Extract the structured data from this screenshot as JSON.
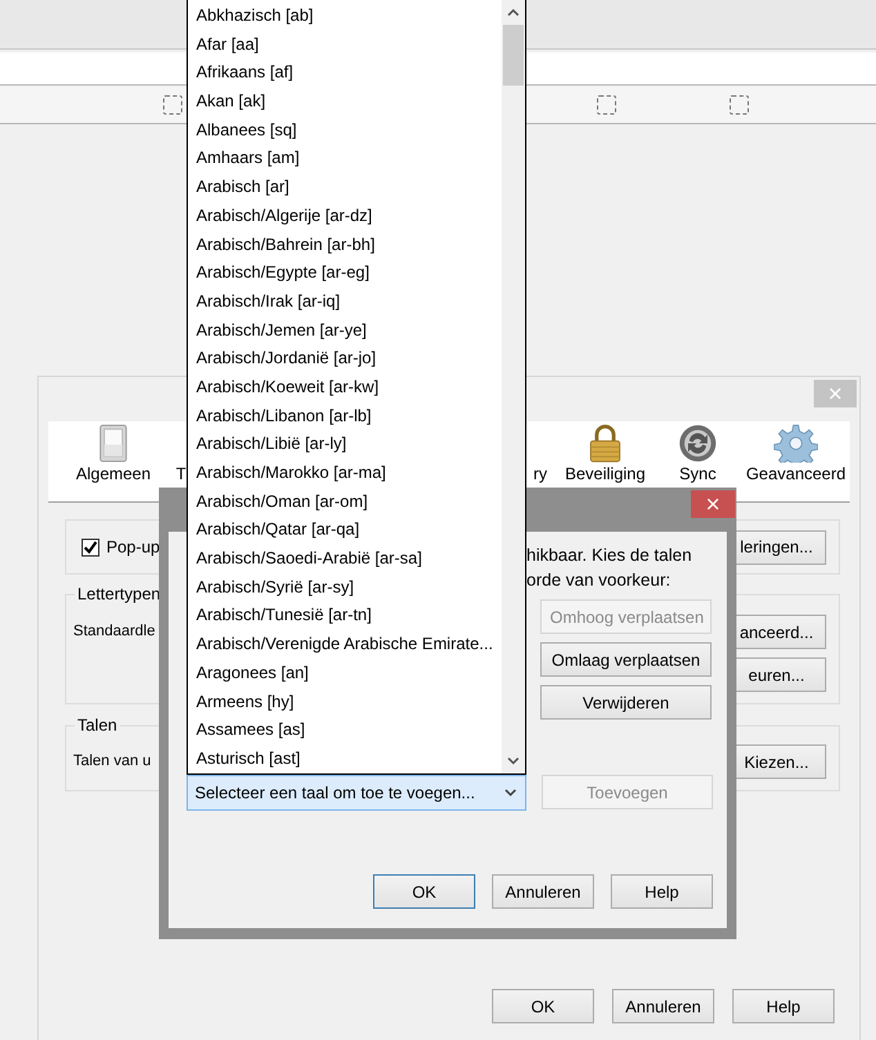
{
  "options_window": {
    "close": "×",
    "tabs": [
      {
        "label": "Algemeen",
        "kind": "switch"
      },
      {
        "label": "T",
        "kind": "hidden"
      },
      {
        "label": "ry",
        "kind": "hidden"
      },
      {
        "label": "Beveiliging",
        "kind": "lock"
      },
      {
        "label": "Sync",
        "kind": "sync"
      },
      {
        "label": "Geavanceerd",
        "kind": "gear"
      }
    ],
    "popups": {
      "label": "Pop-up",
      "checked": true,
      "button": "leringen..."
    },
    "fonts": {
      "title": "Lettertypen",
      "label": "Standaardle",
      "buttons": [
        "anceerd...",
        "euren..."
      ]
    },
    "languages": {
      "title": "Talen",
      "label": "Talen van u",
      "button": "Kiezen..."
    },
    "buttons": [
      "OK",
      "Annuleren",
      "Help"
    ]
  },
  "language_dialog": {
    "close": "×",
    "text_lines": [
      "hikbaar. Kies de talen",
      "orde van voorkeur:"
    ],
    "side_buttons": [
      {
        "label": "Omhoog verplaatsen",
        "disabled": true
      },
      {
        "label": "Omlaag verplaatsen",
        "disabled": false
      },
      {
        "label": "Verwijderen",
        "disabled": false
      }
    ],
    "select": {
      "value": "Selecteer een taal om toe te voegen..."
    },
    "add_button": {
      "label": "Toevoegen",
      "disabled": true
    },
    "buttons": [
      {
        "label": "OK",
        "focused": true
      },
      {
        "label": "Annuleren",
        "focused": false
      },
      {
        "label": "Help",
        "focused": false
      }
    ]
  },
  "dropdown": {
    "items": [
      "Abkhazisch  [ab]",
      "Afar  [aa]",
      "Afrikaans  [af]",
      "Akan  [ak]",
      "Albanees  [sq]",
      "Amhaars  [am]",
      "Arabisch  [ar]",
      "Arabisch/Algerije  [ar-dz]",
      "Arabisch/Bahrein  [ar-bh]",
      "Arabisch/Egypte  [ar-eg]",
      "Arabisch/Irak  [ar-iq]",
      "Arabisch/Jemen  [ar-ye]",
      "Arabisch/Jordanië  [ar-jo]",
      "Arabisch/Koeweit  [ar-kw]",
      "Arabisch/Libanon  [ar-lb]",
      "Arabisch/Libië  [ar-ly]",
      "Arabisch/Marokko  [ar-ma]",
      "Arabisch/Oman  [ar-om]",
      "Arabisch/Qatar  [ar-qa]",
      "Arabisch/Saoedi-Arabië  [ar-sa]",
      "Arabisch/Syrië  [ar-sy]",
      "Arabisch/Tunesië  [ar-tn]",
      "Arabisch/Verenigde Arabische Emirate...",
      "Aragonees  [an]",
      "Armeens  [hy]",
      "Assamees  [as]",
      "Asturisch  [ast]"
    ]
  }
}
